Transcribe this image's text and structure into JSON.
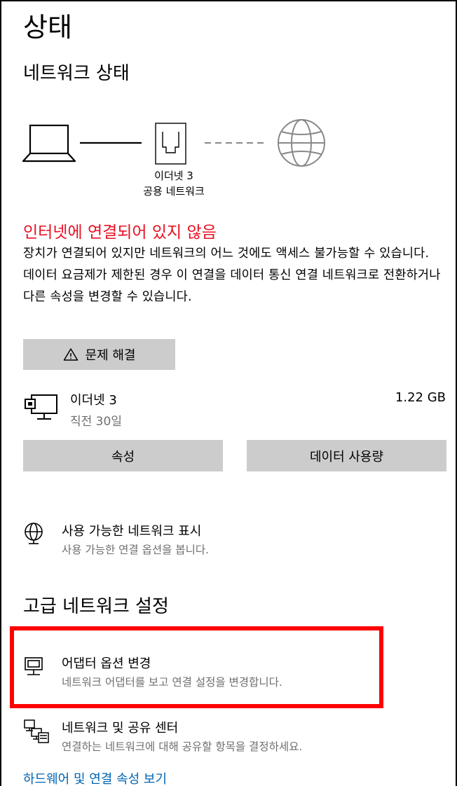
{
  "page_title": "상태",
  "network_status": {
    "heading": "네트워크 상태",
    "adapter_name": "이더넷 3",
    "network_type": "공용 네트워크",
    "error_message": "인터넷에 연결되어 있지 않음",
    "description": "장치가 연결되어 있지만 네트워크의 어느 것에도 액세스 불가능할 수 있습니다. 데이터 요금제가 제한된 경우 이 연결을 데이터 통신 연결 네트워크로 전환하거나 다른 속성을 변경할 수 있습니다.",
    "troubleshoot_label": "문제 해결"
  },
  "connection": {
    "name": "이더넷 3",
    "period": "직전 30일",
    "usage": "1.22 GB",
    "properties_label": "속성",
    "data_usage_label": "데이터 사용량"
  },
  "available_networks": {
    "title": "사용 가능한 네트워크 표시",
    "subtitle": "사용 가능한 연결 옵션을 봅니다."
  },
  "advanced": {
    "heading": "고급 네트워크 설정",
    "items": [
      {
        "title": "어댑터 옵션 변경",
        "subtitle": "네트워크 어댑터를 보고 연결 설정을 변경합니다."
      },
      {
        "title": "네트워크 및 공유 센터",
        "subtitle": "연결하는 네트워크에 대해 공유할 항목을 결정하세요."
      }
    ],
    "hardware_link": "하드웨어 및 연결 속성 보기"
  }
}
